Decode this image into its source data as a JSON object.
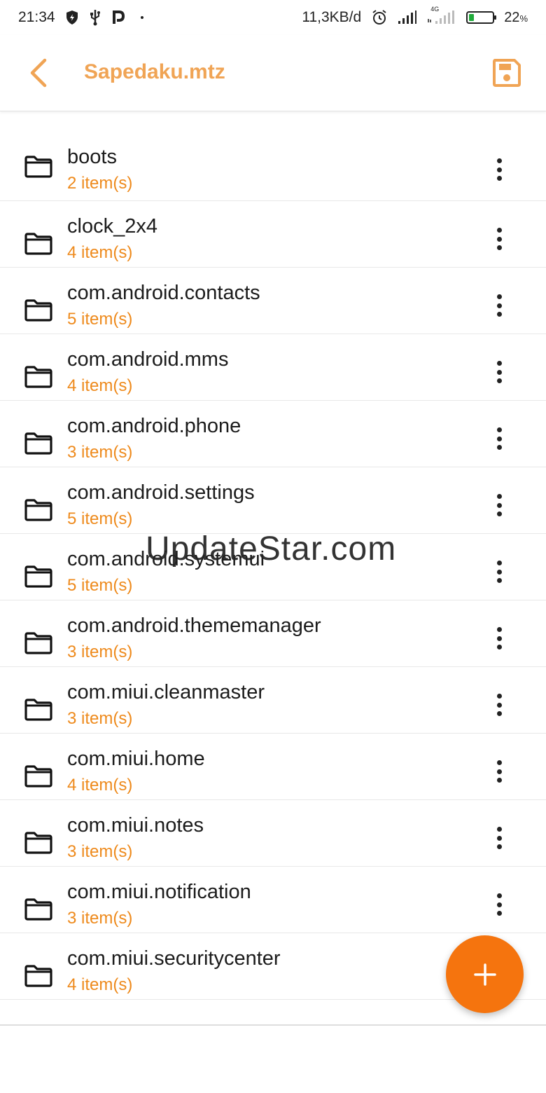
{
  "status_bar": {
    "time": "21:34",
    "net_speed": "11,3KB/d",
    "battery_percent": "22",
    "battery_unit": "%",
    "battery_level": 0.22,
    "network_label": "4G",
    "icons": [
      "shield-icon",
      "usb-icon",
      "p-app-icon",
      "dot-icon",
      "alarm-icon",
      "signal-icon",
      "signal-4g-icon",
      "battery-icon"
    ]
  },
  "appbar": {
    "title": "Sapedaku.mtz",
    "accent": "#f0a455"
  },
  "folders": [
    {
      "name": "boots",
      "count": "2 item(s)"
    },
    {
      "name": "clock_2x4",
      "count": "4 item(s)"
    },
    {
      "name": "com.android.contacts",
      "count": "5 item(s)"
    },
    {
      "name": "com.android.mms",
      "count": "4 item(s)"
    },
    {
      "name": "com.android.phone",
      "count": "3 item(s)"
    },
    {
      "name": "com.android.settings",
      "count": "5 item(s)"
    },
    {
      "name": "com.android.systemui",
      "count": "5 item(s)"
    },
    {
      "name": "com.android.thememanager",
      "count": "3 item(s)"
    },
    {
      "name": "com.miui.cleanmaster",
      "count": "3 item(s)"
    },
    {
      "name": "com.miui.home",
      "count": "4 item(s)"
    },
    {
      "name": "com.miui.notes",
      "count": "3 item(s)"
    },
    {
      "name": "com.miui.notification",
      "count": "3 item(s)"
    },
    {
      "name": "com.miui.securitycenter",
      "count": "4 item(s)"
    }
  ],
  "fab": {
    "label": "+",
    "color": "#f5740e"
  },
  "watermark": "UpdateStar.com"
}
